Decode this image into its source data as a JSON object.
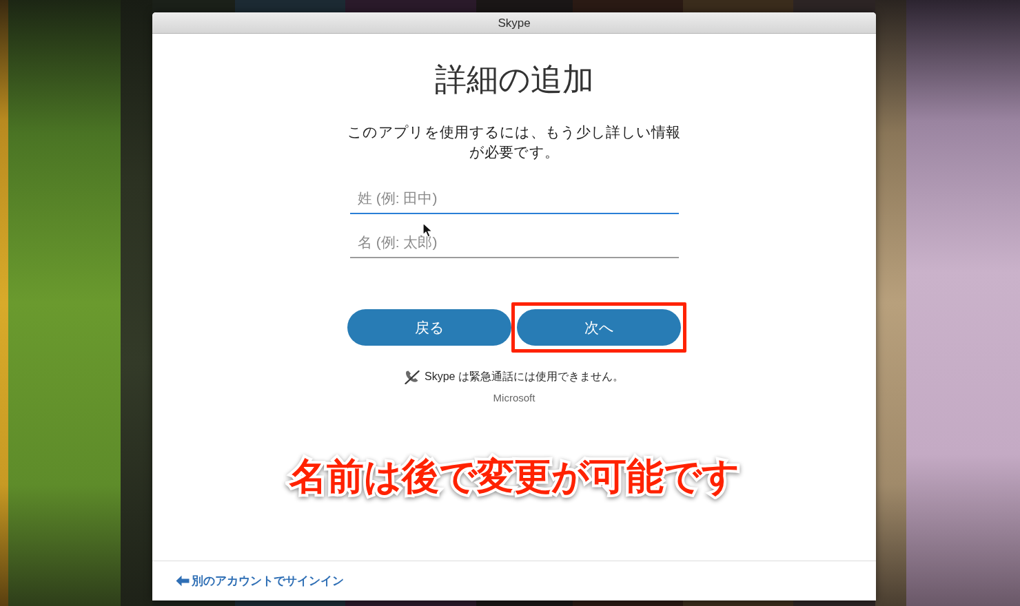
{
  "window": {
    "title": "Skype"
  },
  "heading": "詳細の追加",
  "description": "このアプリを使用するには、もう少し詳しい情報が必要です。",
  "fields": [
    {
      "placeholder": "姓 (例: 田中)",
      "focused": true
    },
    {
      "placeholder": "名 (例: 太郎)",
      "focused": false
    }
  ],
  "buttons": [
    {
      "label": "戻る",
      "highlighted": false
    },
    {
      "label": "次へ",
      "highlighted": true
    }
  ],
  "notice": "Skype は緊急通話には使用できません。",
  "vendor": "Microsoft",
  "caption": "名前は後で変更が可能です",
  "footer_link": {
    "label": "別のアカウントでサインイン"
  }
}
